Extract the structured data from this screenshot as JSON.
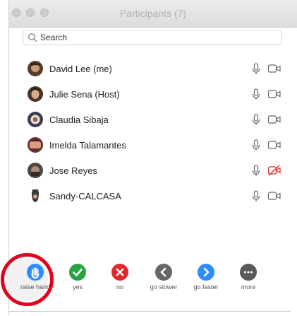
{
  "window": {
    "title": "Participants (7)"
  },
  "search": {
    "placeholder": "Search"
  },
  "participants": [
    {
      "name": "David Lee (me)",
      "avatar": "avatar-david",
      "mic": "mic-on",
      "camera": "camera-on"
    },
    {
      "name": "Julie Sena (Host)",
      "avatar": "avatar-julie",
      "mic": "mic-on",
      "camera": "camera-on"
    },
    {
      "name": "Claudia Sibaja",
      "avatar": "avatar-claudia",
      "mic": "mic-on",
      "camera": "camera-on"
    },
    {
      "name": "Imelda Talamantes",
      "avatar": "avatar-imelda",
      "mic": "mic-on",
      "camera": "camera-on"
    },
    {
      "name": "Jose Reyes",
      "avatar": "avatar-jose",
      "mic": "mic-on",
      "camera": "camera-off"
    },
    {
      "name": "Sandy-CALCASA",
      "avatar": "avatar-sandy",
      "mic": "mic-on",
      "camera": "camera-on"
    }
  ],
  "reactions": [
    {
      "label": "raise hand",
      "icon": "raise-hand-icon",
      "color": "#2d8cff"
    },
    {
      "label": "yes",
      "icon": "check-icon",
      "color": "#26a541"
    },
    {
      "label": "no",
      "icon": "x-icon",
      "color": "#e02828"
    },
    {
      "label": "go slower",
      "icon": "rewind-icon",
      "color": "#666666"
    },
    {
      "label": "go faster",
      "icon": "fast-forward-icon",
      "color": "#2d8cff"
    },
    {
      "label": "more",
      "icon": "more-icon",
      "color": "#555555"
    }
  ],
  "colors": {
    "accent": "#2d8cff",
    "highlight_ring": "#e3001b",
    "camera_off": "#e02828"
  }
}
